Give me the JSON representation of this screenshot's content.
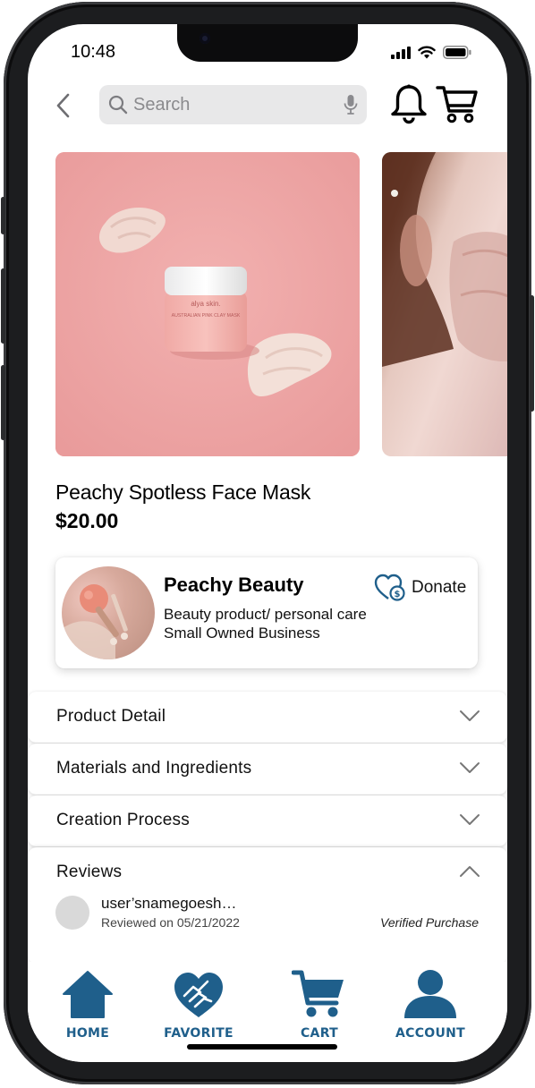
{
  "status_bar": {
    "time": "10:48"
  },
  "header": {
    "search_placeholder": "Search"
  },
  "product": {
    "title": "Peachy Spotless Face Mask",
    "price": "$20.00",
    "jar_brand": "alya skin.",
    "jar_label": "AUSTRALIAN PINK CLAY MASK"
  },
  "seller": {
    "name": "Peachy Beauty",
    "category": "Beauty product/ personal care",
    "business_type": "Small Owned Business",
    "donate_label": "Donate"
  },
  "accordion": [
    {
      "label": "Product Detail",
      "expanded": false
    },
    {
      "label": "Materials and Ingredients",
      "expanded": false
    },
    {
      "label": "Creation Process",
      "expanded": false
    }
  ],
  "reviews": {
    "label": "Reviews",
    "expanded": true,
    "items": [
      {
        "user": "user’snamegoesh…",
        "date": "Reviewed on 05/21/2022",
        "badge": "Verified Purchase"
      }
    ]
  },
  "bottom_nav": [
    {
      "label": "HOME",
      "icon": "home-icon"
    },
    {
      "label": "FAVORITE",
      "icon": "heart-hands-icon"
    },
    {
      "label": "CART",
      "icon": "cart-icon"
    },
    {
      "label": "ACCOUNT",
      "icon": "account-icon"
    }
  ],
  "colors": {
    "accent": "#1f5f8b",
    "hero_bg": "#eea6a5",
    "search_bg": "#e8e8e9"
  }
}
